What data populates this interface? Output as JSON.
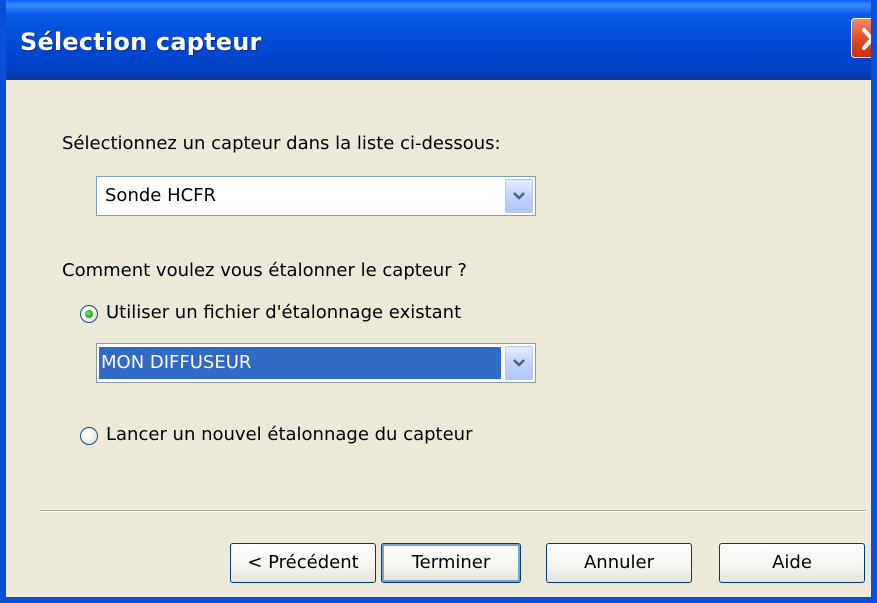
{
  "window": {
    "title": "Sélection capteur"
  },
  "sensor": {
    "prompt": "Sélectionnez un capteur dans la liste ci-dessous:",
    "selected": "Sonde HCFR"
  },
  "calibration": {
    "prompt": "Comment voulez vous étalonner le capteur ?",
    "option_existing": "Utiliser un fichier d'étalonnage existant",
    "existing_file": "MON DIFFUSEUR",
    "option_new": "Lancer un nouvel étalonnage du capteur",
    "selected_option": "existing"
  },
  "buttons": {
    "previous": "< Précédent",
    "finish": "Terminer",
    "cancel": "Annuler",
    "help": "Aide"
  },
  "colors": {
    "title_bar": "#0049d6",
    "dialog_bg": "#ece9d8",
    "selection": "#316ac5",
    "close_button": "#e1552d"
  },
  "icons": {
    "close": "close-icon",
    "dropdown": "chevron-down-icon"
  }
}
